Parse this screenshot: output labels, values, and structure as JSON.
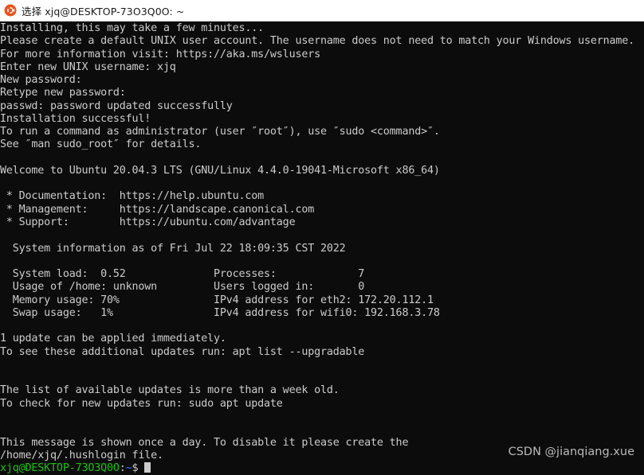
{
  "titlebar": {
    "icon": "ubuntu-logo-icon",
    "title": "选择 xjq@DESKTOP-73O3Q0O: ~"
  },
  "terminal": {
    "background_color": "#0c0c0c",
    "foreground_color": "#cccccc",
    "prompt_user_color": "#16c60c",
    "prompt_path_color": "#3b78ff",
    "lines": [
      "Installing, this may take a few minutes...",
      "Please create a default UNIX user account. The username does not need to match your Windows username.",
      "For more information visit: https://aka.ms/wslusers",
      "Enter new UNIX username: xjq",
      "New password:",
      "Retype new password:",
      "passwd: password updated successfully",
      "Installation successful!",
      "To run a command as administrator (user ″root″), use ″sudo <command>″.",
      "See ″man sudo_root″ for details.",
      "",
      "Welcome to Ubuntu 20.04.3 LTS (GNU/Linux 4.4.0-19041-Microsoft x86_64)",
      "",
      " * Documentation:  https://help.ubuntu.com",
      " * Management:     https://landscape.canonical.com",
      " * Support:        https://ubuntu.com/advantage",
      "",
      "  System information as of Fri Jul 22 18:09:35 CST 2022",
      "",
      "  System load:  0.52              Processes:             7",
      "  Usage of /home: unknown         Users logged in:       0",
      "  Memory usage: 70%               IPv4 address for eth2: 172.20.112.1",
      "  Swap usage:   1%                IPv4 address for wifi0: 192.168.3.78",
      "",
      "1 update can be applied immediately.",
      "To see these additional updates run: apt list --upgradable",
      "",
      "",
      "The list of available updates is more than a week old.",
      "To check for new updates run: sudo apt update",
      "",
      "",
      "This message is shown once a day. To disable it please create the",
      "/home/xjq/.hushlogin file."
    ],
    "prompt": {
      "user_host": "xjq@DESKTOP-73O3Q0O",
      "separator": ":",
      "path": "~",
      "symbol": "$ ",
      "cursor": "block-cursor"
    }
  },
  "watermark": {
    "text": "CSDN @jianqiang.xue"
  }
}
